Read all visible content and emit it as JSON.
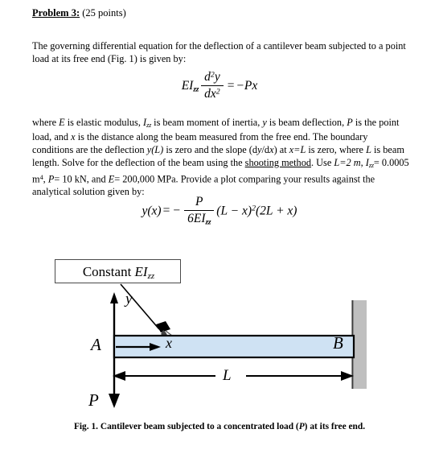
{
  "document": {
    "heading": {
      "problem_label": "Problem 3:",
      "points": "(25 points)"
    },
    "paragraphs": {
      "intro_line1": "The governing differential equation for the deflection of a cantilever beam subjected to a point",
      "intro_line2": "load at its free end (Fig. 1) is given by:",
      "where_part1": "where ",
      "where_E": "E",
      "where_part2": " is elastic modulus, ",
      "where_I": "I",
      "where_I_sub": "zz",
      "where_part3": " is beam moment of inertia, ",
      "where_y": "y",
      "where_part4": " is beam deflection, ",
      "where_P": "P",
      "where_part5": " is the point",
      "where_part6": "load, and ",
      "where_x": "x",
      "where_part7": " is the distance along the beam measured from the free end. The boundary conditions",
      "where_part8": "are the deflection ",
      "where_yL": "y(L)",
      "where_part9": " is zero and the slope (d",
      "where_dy": "y",
      "where_part10": "/d",
      "where_dx": "x",
      "where_part11": ") at ",
      "where_xeqL": "x=L",
      "where_part12": " is zero, where ",
      "where_L": "L",
      "where_part13": " is beam length. Solve",
      "where_part14": "for the deflection of the beam using the ",
      "where_shooting": "shooting method",
      "where_part15": ". Use ",
      "where_Lval": "L=2 m",
      "where_part16": ", ",
      "where_Ival_sym": "I",
      "where_Ival_sub": "zz",
      "where_Ival": "= 0.0005 m",
      "where_Ival_sup": "4",
      "where_part17": ",   ",
      "where_Pval_sym": "P",
      "where_Pval": "= 10",
      "where_part18": "kN, and ",
      "where_Eval_sym": "E",
      "where_Eval": "= 200,000 MPa. Provide a plot comparing your results against the analytical solution",
      "where_part19": "given by:"
    },
    "equations": {
      "governing": {
        "lhs_coeff": "EI",
        "lhs_sub": "zz",
        "num": "d",
        "num_sup": "2",
        "num_var": "y",
        "den": "dx",
        "den_sup": "2",
        "equals": "=",
        "rhs": "−Px"
      },
      "analytic": {
        "lhs": "y(x)",
        "equals": "=",
        "minus": "−",
        "num": "P",
        "den_coeff": "6EI",
        "den_sub": "zz",
        "factor1": "(L − x)",
        "factor1_sup": "2",
        "factor2": "(2L + x)"
      }
    },
    "figure": {
      "callout": {
        "prefix": "Constant ",
        "symbol": "EI",
        "subscript": "zz"
      },
      "labels": {
        "y_axis": "y",
        "x_axis": "x",
        "node_left": "A",
        "node_right": "B",
        "length": "L",
        "load": "P"
      },
      "colors": {
        "beam_fill": "#cfe2f3",
        "beam_stroke": "#000000",
        "wall_fill": "#bfbfbf",
        "wall_edge": "#3f3f3f",
        "callout_border": "#4a4a4a"
      }
    },
    "caption": {
      "prefix": "Fig. 1. Cantilever beam subjected to a concentrated load (",
      "symbol": "P",
      "suffix": ") at its free end."
    }
  }
}
